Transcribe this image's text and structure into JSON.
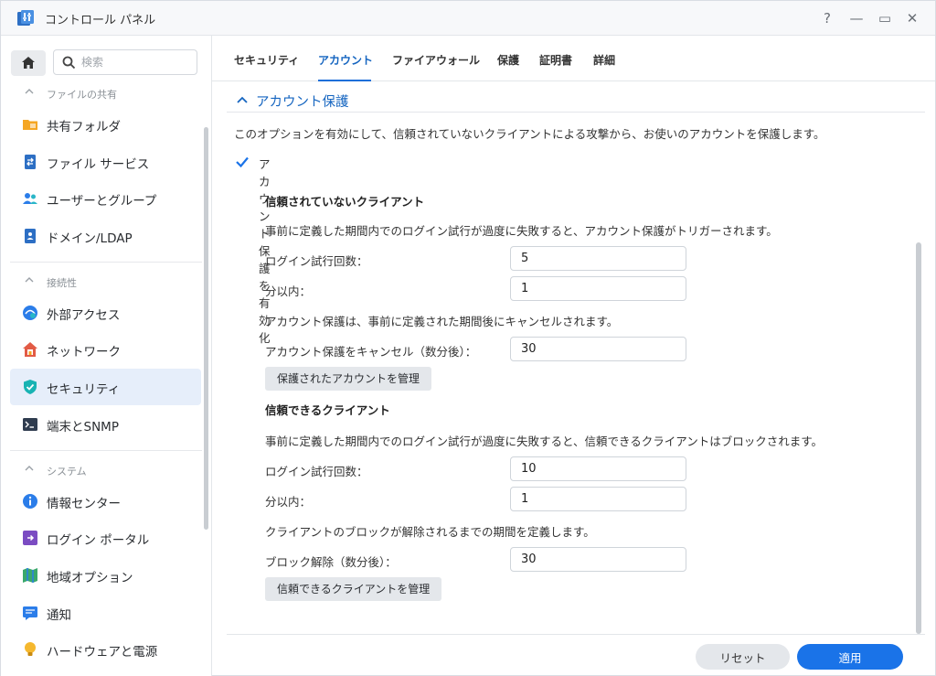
{
  "window": {
    "title": "コントロール パネル",
    "help": "?",
    "minimize": "—",
    "maximize": "▭",
    "close": "✕"
  },
  "sidebar": {
    "search_placeholder": "検索",
    "sections": [
      {
        "label": "ファイルの共有",
        "items": [
          "共有フォルダ",
          "ファイル サービス",
          "ユーザーとグループ",
          "ドメイン/LDAP"
        ]
      },
      {
        "label": "接続性",
        "items": [
          "外部アクセス",
          "ネットワーク",
          "セキュリティ",
          "端末とSNMP"
        ]
      },
      {
        "label": "システム",
        "items": [
          "情報センター",
          "ログイン ポータル",
          "地域オプション",
          "通知",
          "ハードウェアと電源"
        ]
      }
    ],
    "active_item": "セキュリティ"
  },
  "tabs": [
    "セキュリティ",
    "アカウント",
    "ファイアウォール",
    "保護",
    "証明書",
    "詳細"
  ],
  "active_tab": "アカウント",
  "account_protection": {
    "heading": "アカウント保護",
    "description": "このオプションを有効にして、信頼されていないクライアントによる攻撃から、お使いのアカウントを保護します。",
    "enable_label": "アカウント保護を有効化",
    "enabled": true,
    "untrusted": {
      "title": "信頼されていないクライアント",
      "description": "事前に定義した期間内でのログイン試行が過度に失敗すると、アカウント保護がトリガーされます。",
      "attempts_label": "ログイン試行回数：",
      "attempts_value": "5",
      "within_label": "分以内：",
      "within_value": "1",
      "cancel_note": "アカウント保護は、事前に定義された期間後にキャンセルされます。",
      "cancel_label": "アカウント保護をキャンセル（数分後）：",
      "cancel_value": "30",
      "manage_button": "保護されたアカウントを管理"
    },
    "trusted": {
      "title": "信頼できるクライアント",
      "description": "事前に定義した期間内でのログイン試行が過度に失敗すると、信頼できるクライアントはブロックされます。",
      "attempts_label": "ログイン試行回数：",
      "attempts_value": "10",
      "within_label": "分以内：",
      "within_value": "1",
      "unblock_note": "クライアントのブロックが解除されるまでの期間を定義します。",
      "unblock_label": "ブロック解除（数分後）：",
      "unblock_value": "30",
      "manage_button": "信頼できるクライアントを管理"
    }
  },
  "footer": {
    "reset": "リセット",
    "apply": "適用"
  },
  "colors": {
    "accent": "#1a73e8",
    "active_bg": "#e6eefa"
  }
}
